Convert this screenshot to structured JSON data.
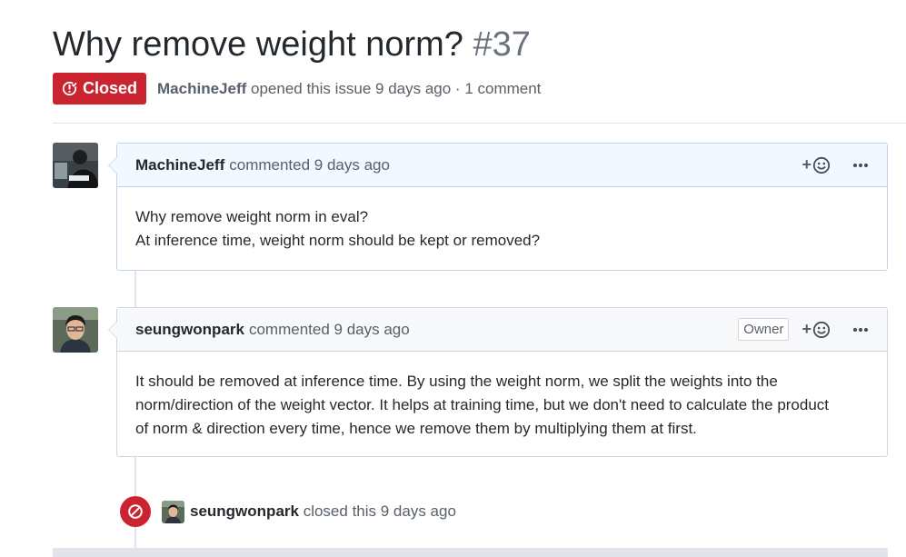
{
  "issue": {
    "title": "Why remove weight norm?",
    "number": "#37",
    "state": "Closed",
    "author": "MachineJeff",
    "opened_text": "opened this issue 9 days ago · 1 comment"
  },
  "comments": [
    {
      "author": "MachineJeff",
      "time_text": "commented 9 days ago",
      "body": [
        "Why remove weight norm in eval?",
        "At inference time, weight norm should be kept or removed?"
      ]
    },
    {
      "author": "seungwonpark",
      "time_text": "commented 9 days ago",
      "badge": "Owner",
      "body": [
        "It should be removed at inference time. By using the weight norm, we split the weights into the",
        "norm/direction of the weight vector. It helps at training time, but we don't need to calculate the product",
        "of norm & direction every time, hence we remove them by multiplying them at first."
      ]
    }
  ],
  "event": {
    "actor": "seungwonpark",
    "text": "closed this 9 days ago"
  },
  "icons": {
    "state": "issue-closed-icon",
    "reaction": "smiley-icon",
    "more": "kebab-horizontal-icon",
    "event": "circle-slash-icon"
  },
  "colors": {
    "closed_red": "#cb2431",
    "header_blue": "#f1f8ff",
    "header_gray": "#f6f8fa",
    "muted_text": "#586069"
  }
}
